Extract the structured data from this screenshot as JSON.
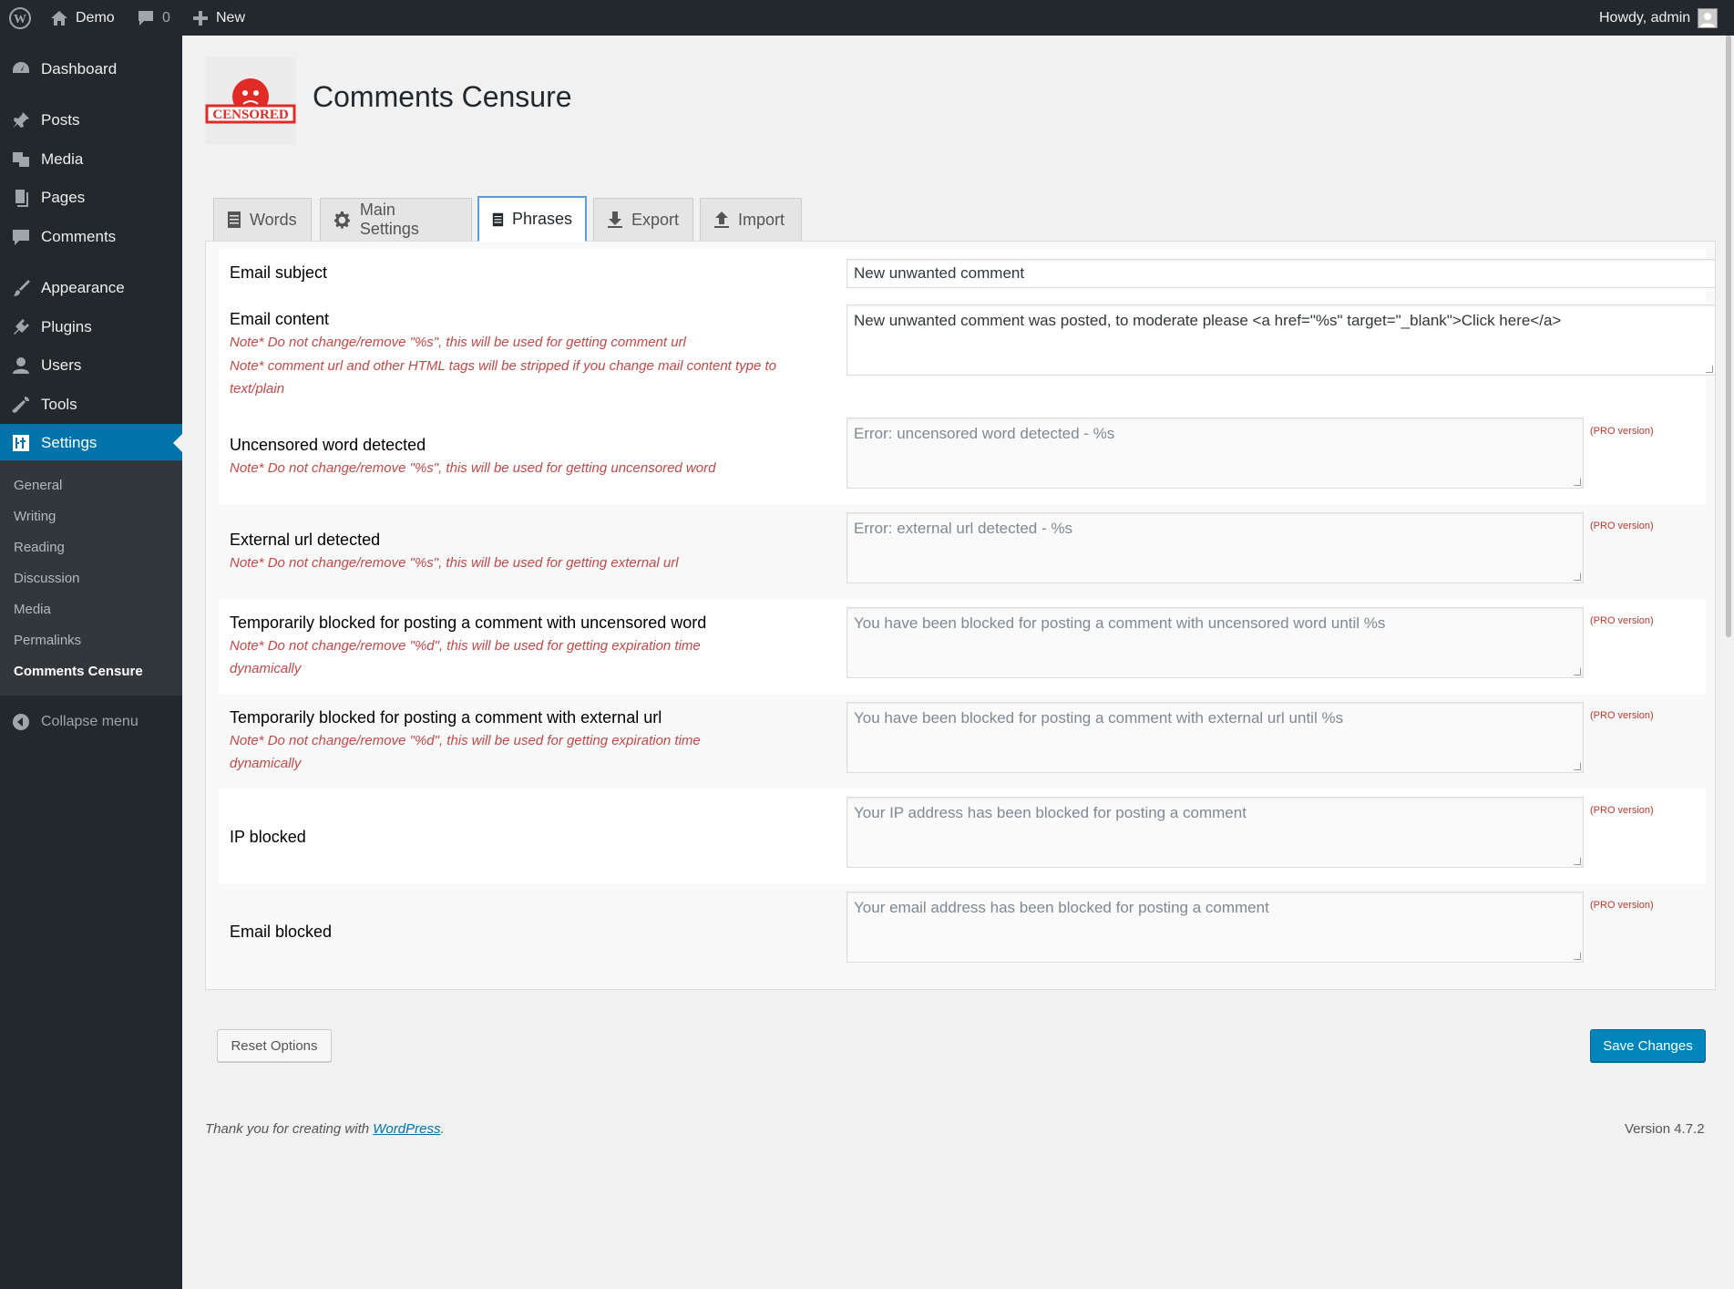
{
  "adminbar": {
    "site_name": "Demo",
    "comments_count": "0",
    "new_label": "New",
    "greeting": "Howdy, admin"
  },
  "sidebar": {
    "items": [
      {
        "label": "Dashboard",
        "icon": "dashboard-icon"
      },
      {
        "label": "Posts",
        "icon": "pin-icon"
      },
      {
        "label": "Media",
        "icon": "media-icon"
      },
      {
        "label": "Pages",
        "icon": "page-icon"
      },
      {
        "label": "Comments",
        "icon": "comment-icon"
      },
      {
        "label": "Appearance",
        "icon": "brush-icon"
      },
      {
        "label": "Plugins",
        "icon": "plugin-icon"
      },
      {
        "label": "Users",
        "icon": "user-icon"
      },
      {
        "label": "Tools",
        "icon": "wrench-icon"
      },
      {
        "label": "Settings",
        "icon": "settings-icon"
      }
    ],
    "submenu": [
      "General",
      "Writing",
      "Reading",
      "Discussion",
      "Media",
      "Permalinks",
      "Comments Censure"
    ],
    "collapse_label": "Collapse menu"
  },
  "header": {
    "logo_text": "CENSORED",
    "title": "Comments Censure"
  },
  "tabs": [
    {
      "label": "Words",
      "icon": "document-icon"
    },
    {
      "label": "Main Settings",
      "icon": "gear-icon"
    },
    {
      "label": "Phrases",
      "icon": "document-icon"
    },
    {
      "label": "Export",
      "icon": "download-icon"
    },
    {
      "label": "Import",
      "icon": "upload-icon"
    }
  ],
  "form": {
    "pro_label": "(PRO version)",
    "rows": [
      {
        "title": "Email subject",
        "notes": [],
        "value": "New unwanted comment",
        "pro": false
      },
      {
        "title": "Email content",
        "notes": [
          "Note* Do not change/remove \"%s\", this will be used for getting comment url",
          "Note* comment url and other HTML tags will be stripped if you change mail content type to text/plain"
        ],
        "value": "New unwanted comment was posted, to moderate please <a href=\"%s\" target=\"_blank\">Click here</a>",
        "pro": false
      },
      {
        "title": "Uncensored word detected",
        "notes": [
          "Note* Do not change/remove \"%s\", this will be used for getting uncensored word"
        ],
        "value": "Error: uncensored word detected - %s",
        "pro": true
      },
      {
        "title": "External url detected",
        "notes": [
          "Note* Do not change/remove \"%s\", this will be used for getting external url"
        ],
        "value": "Error: external url detected - %s",
        "pro": true
      },
      {
        "title": "Temporarily blocked for posting a comment with uncensored word",
        "notes": [
          "Note* Do not change/remove \"%d\", this will be used for getting expiration time dynamically"
        ],
        "value": "You have been blocked for posting a comment with uncensored word until %s",
        "pro": true
      },
      {
        "title": "Temporarily blocked for posting a comment with external url",
        "notes": [
          "Note* Do not change/remove \"%d\", this will be used for getting expiration time dynamically"
        ],
        "value": "You have been blocked for posting a comment with external url until %s",
        "pro": true
      },
      {
        "title": "IP blocked",
        "notes": [],
        "value": "Your IP address has been blocked for posting a comment",
        "pro": true
      },
      {
        "title": "Email blocked",
        "notes": [],
        "value": "Your email address has been blocked for posting a comment",
        "pro": true
      }
    ]
  },
  "buttons": {
    "reset": "Reset Options",
    "save": "Save Changes"
  },
  "footer": {
    "thanks_prefix": "Thank you for creating with ",
    "thanks_link": "WordPress",
    "thanks_suffix": ".",
    "version": "Version 4.7.2"
  },
  "colors": {
    "adminbar": "#23282d",
    "accent": "#0073aa",
    "note": "#c04a48",
    "pro": "#c0392b"
  }
}
